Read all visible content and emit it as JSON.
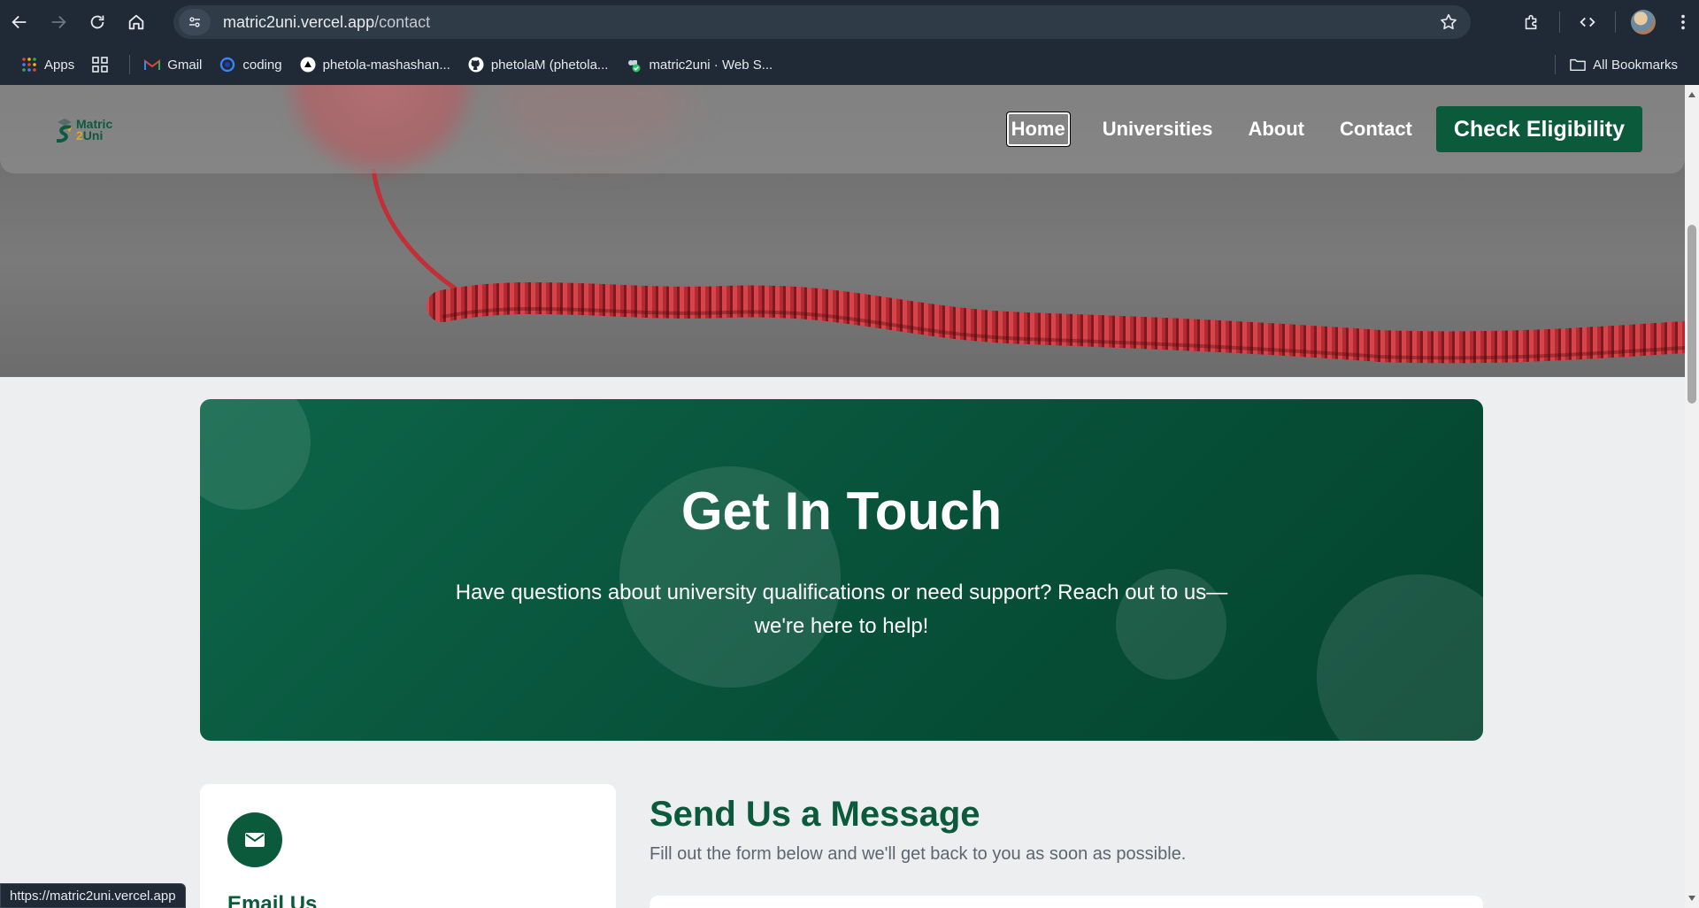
{
  "browser": {
    "url_host": "matric2uni.vercel.app",
    "url_path": "/contact",
    "bookmarks": [
      {
        "label": "Apps",
        "icon": "apps-grid-icon"
      },
      {
        "label": "",
        "icon": "tab-groups-icon"
      },
      {
        "label": "Gmail",
        "icon": "gmail-icon"
      },
      {
        "label": "coding",
        "icon": "coding-icon"
      },
      {
        "label": "phetola-mashashan...",
        "icon": "vercel-icon"
      },
      {
        "label": "phetolaM (phetola...",
        "icon": "github-icon"
      },
      {
        "label": "matric2uni · Web S...",
        "icon": "web-service-icon"
      }
    ],
    "all_bookmarks_label": "All Bookmarks",
    "status_url": "https://matric2uni.vercel.app"
  },
  "site": {
    "logo_line1": "Matric",
    "logo_two": "2",
    "logo_line2": "Uni",
    "nav": {
      "home": "Home",
      "universities": "Universities",
      "about": "About",
      "contact": "Contact",
      "cta": "Check Eligibility"
    }
  },
  "banner": {
    "title": "Get In Touch",
    "line1": "Have questions about university qualifications or need support? Reach out to us—",
    "line2": "we're here to help!"
  },
  "contact_card": {
    "title": "Email Us"
  },
  "form": {
    "title": "Send Us a Message",
    "subtitle": "Fill out the form below and we'll get back to you as soon as possible."
  },
  "colors": {
    "brand_green": "#0b5a3c",
    "chrome_bg": "#202a36",
    "page_bg": "#eceef0"
  }
}
